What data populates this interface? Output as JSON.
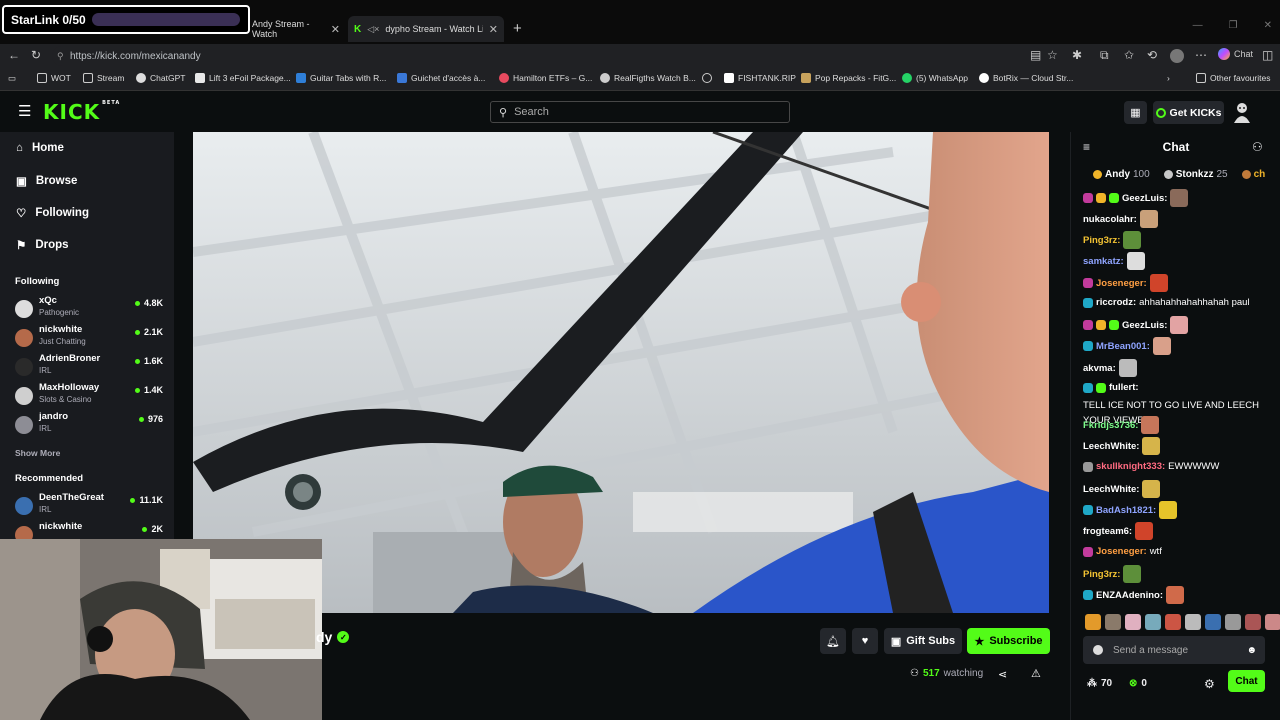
{
  "overlay": {
    "starlink_label": "StarLink 0/50"
  },
  "browser": {
    "tabs": [
      {
        "label": "Andy Stream - Watch"
      },
      {
        "label": "dypho Stream - Watch Live or"
      }
    ],
    "url": "https://kick.com/mexicanandy",
    "chat_button": "Chat",
    "bookmarks": [
      "WOT",
      "Stream",
      "ChatGPT",
      "Lift 3 eFoil Package...",
      "Guitar Tabs with R...",
      "Guichet d'accès à...",
      "Hamilton ETFs – G...",
      "RealFigths Watch B...",
      "FISHTANK.RIP",
      "Pop Repacks - FitG...",
      "(5) WhatsApp",
      "BotRix — Cloud Str..."
    ],
    "other_favourites": "Other favourites"
  },
  "header": {
    "logo": "KICK",
    "logo_tag": "BETA",
    "search_placeholder": "Search",
    "get_kicks": "Get KICKs"
  },
  "sidebar": {
    "nav": [
      "Home",
      "Browse",
      "Following",
      "Drops"
    ],
    "following_title": "Following",
    "following": [
      {
        "name": "xQc",
        "category": "Pathogenic",
        "viewers": "4.8K"
      },
      {
        "name": "nickwhite",
        "category": "Just Chatting",
        "viewers": "2.1K"
      },
      {
        "name": "AdrienBroner",
        "category": "IRL",
        "viewers": "1.6K"
      },
      {
        "name": "MaxHolloway",
        "category": "Slots & Casino",
        "viewers": "1.4K"
      },
      {
        "name": "jandro",
        "category": "IRL",
        "viewers": "976"
      }
    ],
    "show_more": "Show More",
    "recommended_title": "Recommended",
    "recommended": [
      {
        "name": "DeenTheGreat",
        "category": "IRL",
        "viewers": "11.1K"
      },
      {
        "name": "nickwhite",
        "category": "Just Chatting",
        "viewers": "2K"
      }
    ]
  },
  "stream": {
    "name_fragment": "dy",
    "gift_subs": "Gift Subs",
    "subscribe": "Subscribe",
    "watching_count": "517",
    "watching_label": "watching"
  },
  "chat": {
    "title": "Chat",
    "pinned": [
      {
        "name": "Andy",
        "count": "100"
      },
      {
        "name": "Stonkzz",
        "count": "25"
      },
      {
        "name": "ch",
        "count": ""
      }
    ],
    "messages": [
      {
        "user": "GeezLuis:",
        "color": "#ffffff",
        "text": "",
        "emote": "#8a6a5a"
      },
      {
        "user": "nukacolahr:",
        "color": "#ffffff",
        "text": "",
        "emote": "#c9a07a"
      },
      {
        "user": "Ping3rz:",
        "color": "#f2c233",
        "text": "",
        "emote": "#5d8f3a"
      },
      {
        "user": "samkatz:",
        "color": "#8fa4ff",
        "text": "",
        "emote": "#dddddd"
      },
      {
        "user": "Joseneger:",
        "color": "#ff9f43",
        "text": "",
        "emote": "#d0442a"
      },
      {
        "user": "riccrodz:",
        "color": "#ffffff",
        "text": "ahhahahhahahhahah paul",
        "emote": ""
      },
      {
        "user": "GeezLuis:",
        "color": "#ffffff",
        "text": "",
        "emote": "#e2a3a3"
      },
      {
        "user": "MrBean001:",
        "color": "#8fa4ff",
        "text": "",
        "emote": "#d9a08a"
      },
      {
        "user": "akvma:",
        "color": "#ffffff",
        "text": "",
        "emote": "#bbbbbb"
      },
      {
        "user": "fullert:",
        "color": "#ffffff",
        "text": "TELL ICE NOT TO GO LIVE AND LEECH YOUR VIEWERS",
        "emote": ""
      },
      {
        "user": "Fkridjs3736:",
        "color": "#7cfc8a",
        "text": "",
        "emote": "#c6765a"
      },
      {
        "user": "LeechWhite:",
        "color": "#ffffff",
        "text": "",
        "emote": "#d6b44a"
      },
      {
        "user": "skullknight333:",
        "color": "#ff6b81",
        "text": "EWWWWW",
        "emote": ""
      },
      {
        "user": "LeechWhite:",
        "color": "#ffffff",
        "text": "",
        "emote": "#d6b44a"
      },
      {
        "user": "BadAsh1821:",
        "color": "#8fa4ff",
        "text": "",
        "emote": "#e6c42a"
      },
      {
        "user": "frogteam6:",
        "color": "#ffffff",
        "text": "",
        "emote": "#d0442a"
      },
      {
        "user": "Joseneger:",
        "color": "#ff9f43",
        "text": "wtf",
        "emote": ""
      },
      {
        "user": "Ping3rz:",
        "color": "#f2c233",
        "text": "",
        "emote": "#5d8f3a"
      },
      {
        "user": "ENZAAdenino:",
        "color": "#ffffff",
        "text": "",
        "emote": "#d06a4a"
      }
    ],
    "send_placeholder": "Send a message",
    "points": "70",
    "kicks": "0",
    "chat_button": "Chat"
  }
}
